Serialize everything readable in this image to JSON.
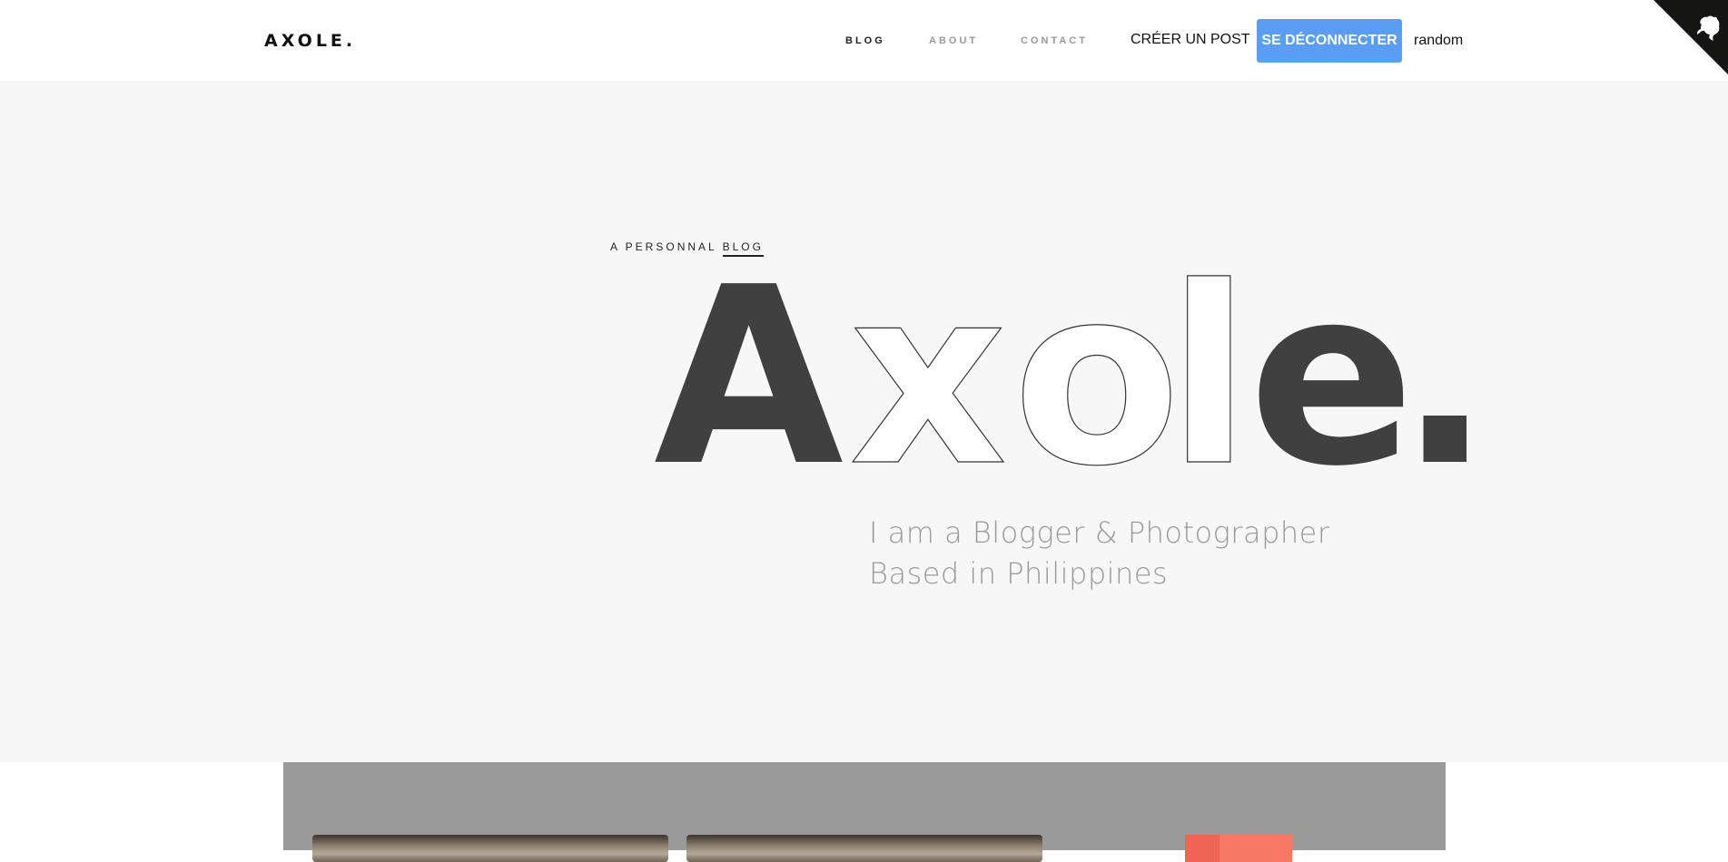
{
  "header": {
    "logo": "AXOLE.",
    "nav": {
      "blog": "BLOG",
      "about": "ABOUT",
      "contact": "CONTACT",
      "create_post": "CRÉER UN POST"
    },
    "logout_label": "SE DÉCONNECTER",
    "username": "random",
    "github_icon": "github-octocat-icon"
  },
  "hero": {
    "subtitle_prefix": "A PERSONNAL",
    "subtitle_highlight": "BLOG",
    "title_letters": [
      "A",
      "x",
      "o",
      "l",
      "e",
      "."
    ],
    "tagline_line1": "I am a Blogger & Photographer",
    "tagline_line2": "Based in Philippines"
  },
  "colors": {
    "accent_button": "#5b9df5",
    "hero_background": "#f7f7f7",
    "title_dark": "#404040",
    "posts_background": "#9a9a9a",
    "post_accent": "#f57764"
  }
}
